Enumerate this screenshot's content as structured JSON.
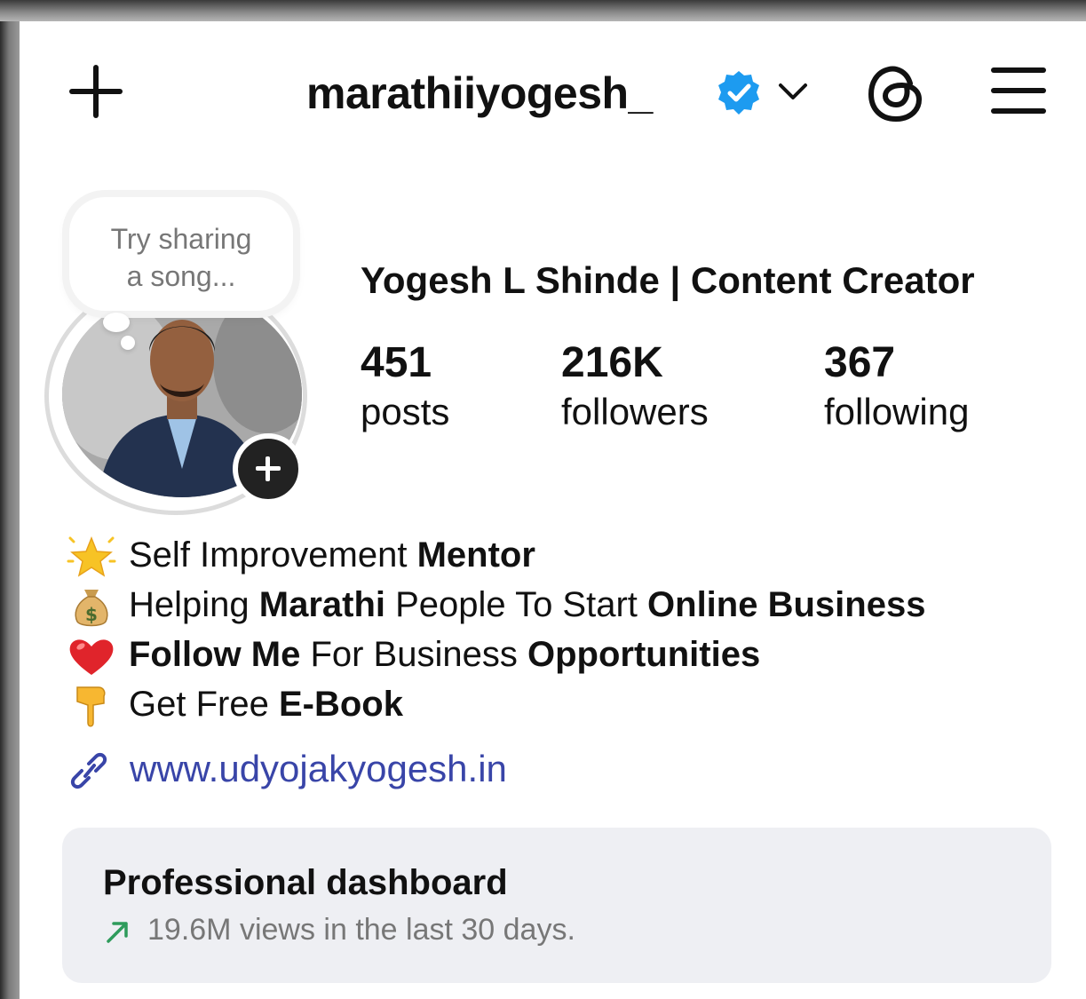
{
  "header": {
    "username": "marathiiyogesh_",
    "icons": [
      "plus-icon",
      "verified-badge-icon",
      "chevron-down-icon",
      "threads-icon",
      "menu-icon"
    ],
    "verified_color": "#1d9bf0"
  },
  "profile": {
    "song_prompt_line1": "Try sharing",
    "song_prompt_line2": "a song...",
    "display_name": "Yogesh L Shinde | Content Creator",
    "stats": [
      {
        "value": "451",
        "label": "posts"
      },
      {
        "value": "216K",
        "label": "followers"
      },
      {
        "value": "367",
        "label": "following"
      }
    ]
  },
  "bio": {
    "line1": {
      "emoji": "glowing-star-icon",
      "text": "Self Improvement ",
      "bold": "Mentor"
    },
    "line2": {
      "emoji": "money-bag-icon",
      "text1": "Helping ",
      "bold1": "Marathi",
      "text2": " People To Start ",
      "bold2": "Online Business"
    },
    "line3": {
      "emoji": "red-heart-icon",
      "bold1": "Follow Me",
      "text1": " For Business ",
      "bold2": "Opportunities"
    },
    "line4": {
      "emoji": "pointing-down-icon",
      "text1": "Get Free ",
      "bold1": "E-Book"
    }
  },
  "link": {
    "icon": "link-icon",
    "url": "www.udyojakyogesh.in",
    "color": "#3945a8"
  },
  "dashboard": {
    "title": "Professional dashboard",
    "subtitle": "19.6M views in the last 30 days.",
    "arrow_color": "#2e9b5b"
  }
}
